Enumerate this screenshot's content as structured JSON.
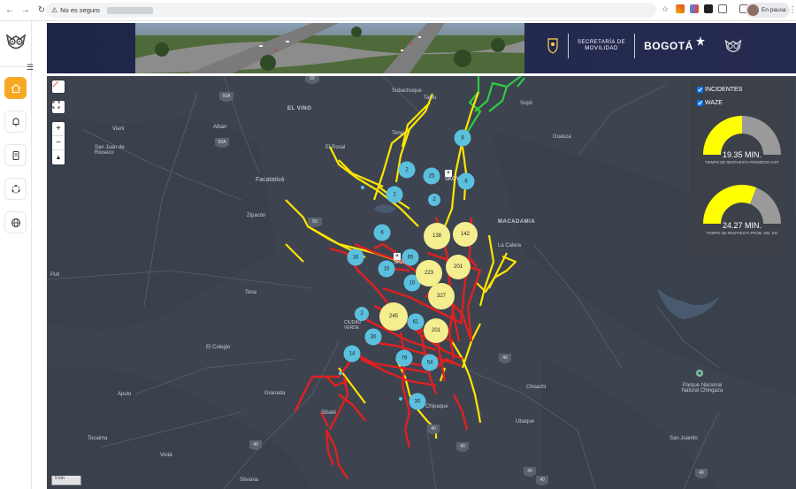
{
  "browser": {
    "security_label": "No es seguro",
    "profile_label": "En pausa"
  },
  "header": {
    "secretaria_label": "SECRETARÍA DE\nMOVILIDAD",
    "bogota_label": "BOGOTÁ"
  },
  "map": {
    "scale_label": "5 km",
    "place_labels": [
      {
        "text": "Subachoque"
      },
      {
        "text": "Tabio"
      },
      {
        "text": "EL VINO"
      },
      {
        "text": "Albán"
      },
      {
        "text": "San Juan de Rioseco"
      },
      {
        "text": "Vianí"
      },
      {
        "text": "El Rosal"
      },
      {
        "text": "Facatativá"
      },
      {
        "text": "Zipacón"
      },
      {
        "text": "Tena"
      },
      {
        "text": "El Colegio"
      },
      {
        "text": "Granada"
      },
      {
        "text": "Apulo"
      },
      {
        "text": "Tocaima"
      },
      {
        "text": "Viotá"
      },
      {
        "text": "Silvania"
      },
      {
        "text": "Sibaté"
      },
      {
        "text": "Chipaque"
      },
      {
        "text": "Choachí"
      },
      {
        "text": "Ubaque"
      },
      {
        "text": "MACADAMIA"
      },
      {
        "text": "La Calera"
      },
      {
        "text": "Guasca"
      },
      {
        "text": "Sopó"
      },
      {
        "text": "Tenjo"
      },
      {
        "text": "Parque Nacional Natural Chingaza"
      },
      {
        "text": "San Juanito"
      },
      {
        "text": "Pulí"
      },
      {
        "text": "CIUDAD VERDE"
      }
    ],
    "road_badges": [
      "50A",
      "50A",
      "50",
      "50",
      "40",
      "40",
      "40",
      "40",
      "40",
      "40",
      "40"
    ],
    "airport_labels": [
      "SKGY",
      "SKBO"
    ],
    "clusters": [
      {
        "value": 8,
        "size": "small"
      },
      {
        "value": 2,
        "size": "small"
      },
      {
        "value": 25,
        "size": "small"
      },
      {
        "value": 6,
        "size": "small"
      },
      {
        "value": 2,
        "size": "small"
      },
      {
        "value": 2,
        "size": "small"
      },
      {
        "value": 6,
        "size": "small"
      },
      {
        "value": 138,
        "size": "large"
      },
      {
        "value": 142,
        "size": "large"
      },
      {
        "value": 16,
        "size": "small"
      },
      {
        "value": 65,
        "size": "small"
      },
      {
        "value": 15,
        "size": "small"
      },
      {
        "value": 10,
        "size": "small"
      },
      {
        "value": 223,
        "size": "large"
      },
      {
        "value": 201,
        "size": "large"
      },
      {
        "value": 327,
        "size": "large"
      },
      {
        "value": 2,
        "size": "small"
      },
      {
        "value": 245,
        "size": "large"
      },
      {
        "value": 61,
        "size": "small"
      },
      {
        "value": 201,
        "size": "large"
      },
      {
        "value": 30,
        "size": "small"
      },
      {
        "value": 14,
        "size": "small"
      },
      {
        "value": 79,
        "size": "small"
      },
      {
        "value": 54,
        "size": "small"
      },
      {
        "value": 30,
        "size": "small"
      }
    ]
  },
  "panel": {
    "incidentes_label": "INCIDENTES",
    "waze_label": "WAZE",
    "gauge1": {
      "value_label": "19.35 MIN.",
      "caption": "TIEMPO DE RESPUESTA PROMEDIO HIST",
      "fraction": 0.5
    },
    "gauge2": {
      "value_label": "24.27 MIN.",
      "caption": "TIEMPO DE RESPUESTA PROM. DEL DIA",
      "fraction": 0.62
    }
  },
  "colors": {
    "accent": "#f7a823",
    "incident_line": "#e02020",
    "waze_line": "#ffe500",
    "green_line": "#2ecc40",
    "cluster_small": "#5bc0de",
    "cluster_large": "#f5ee8f",
    "gauge_fill": "#ffff00",
    "gauge_track": "#9a9a9a"
  }
}
